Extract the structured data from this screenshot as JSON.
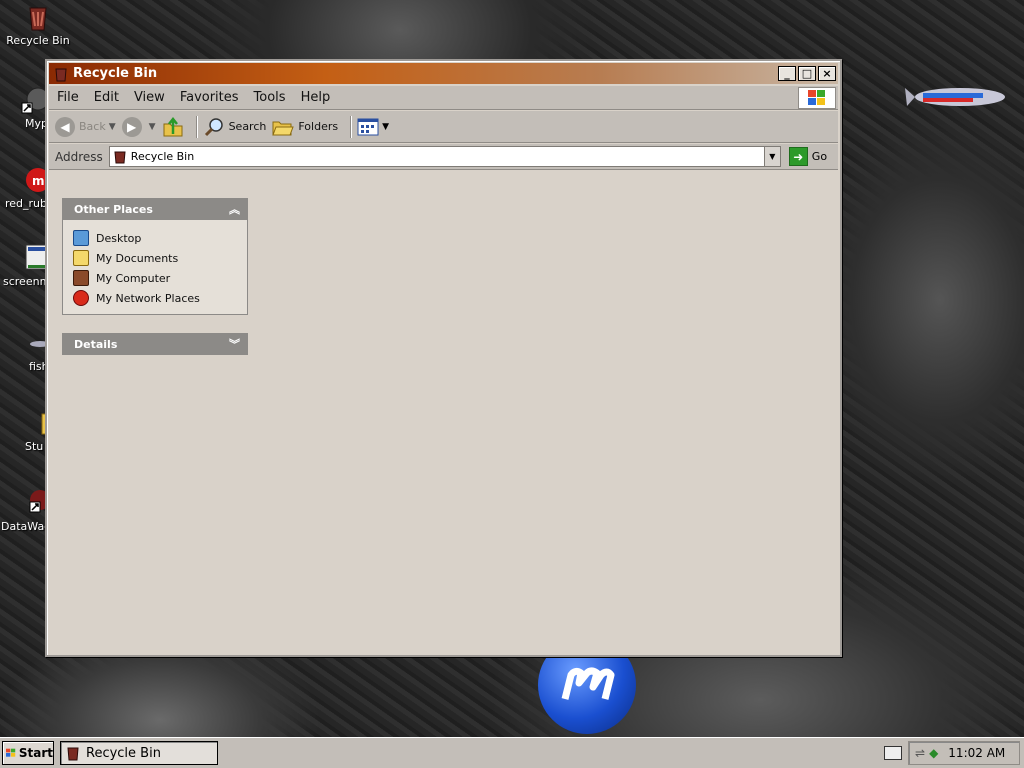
{
  "desktop": {
    "icons": [
      {
        "label": "Recycle Bin"
      },
      {
        "label": "Myp"
      },
      {
        "label": "red_rub"
      },
      {
        "label": "screenm"
      },
      {
        "label": "fish"
      },
      {
        "label": "Stu"
      },
      {
        "label": "DataWag"
      }
    ]
  },
  "window": {
    "title": "Recycle Bin",
    "controls": {
      "minimize": "_",
      "maximize": "□",
      "close": "×"
    },
    "menu": [
      "File",
      "Edit",
      "View",
      "Favorites",
      "Tools",
      "Help"
    ],
    "toolbar": {
      "back": "Back",
      "forward": "",
      "search": "Search",
      "folders": "Folders"
    },
    "address": {
      "label": "Address",
      "value": "Recycle Bin",
      "go": "Go"
    },
    "panels": {
      "other_places": {
        "title": "Other Places",
        "items": [
          "Desktop",
          "My Documents",
          "My Computer",
          "My Network Places"
        ]
      },
      "details": {
        "title": "Details"
      }
    }
  },
  "taskbar": {
    "start": "Start",
    "task": "Recycle Bin",
    "clock": "11:02 AM"
  },
  "colors": {
    "titlebar_start": "#8a2a04",
    "titlebar_mid": "#c45f14",
    "panel_header": "#8c8a87",
    "window_bg": "#d9d2c9"
  }
}
